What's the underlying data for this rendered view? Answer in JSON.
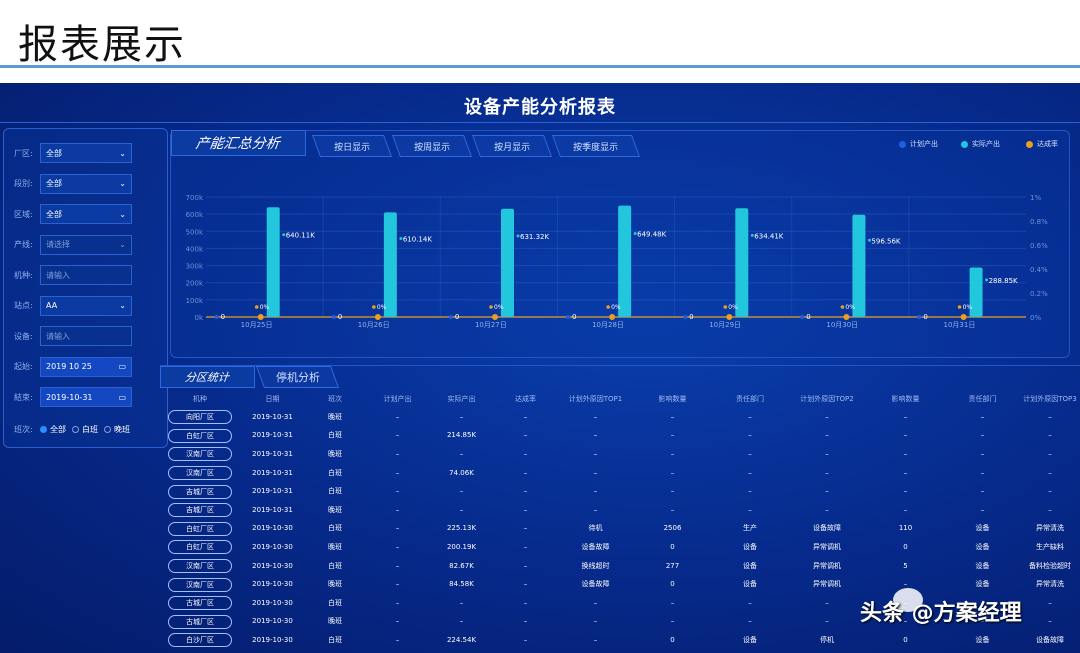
{
  "page_title": "报表展示",
  "dashboard_title": "设备产能分析报表",
  "filters": [
    {
      "label": "厂区:",
      "value": "全部",
      "type": "select"
    },
    {
      "label": "段別:",
      "value": "全部",
      "type": "select"
    },
    {
      "label": "区域:",
      "value": "全部",
      "type": "select"
    },
    {
      "label": "产线:",
      "placeholder": "请选择",
      "type": "select"
    },
    {
      "label": "机种:",
      "placeholder": "请输入",
      "type": "input"
    },
    {
      "label": "站点:",
      "value": "AA",
      "type": "select"
    },
    {
      "label": "设备:",
      "placeholder": "请输入",
      "type": "input"
    },
    {
      "label": "起始:",
      "value": "2019 10 25",
      "type": "date"
    },
    {
      "label": "結束:",
      "value": "2019-10-31",
      "type": "date"
    }
  ],
  "shift": {
    "label": "班次:",
    "options": [
      "全部",
      "白班",
      "晚班"
    ],
    "selected": "全部"
  },
  "chart_tabs": {
    "main": "产能汇总分析",
    "tabs": [
      "按日显示",
      "按周显示",
      "按月显示",
      "按季度显示"
    ]
  },
  "chart_data": {
    "type": "bar",
    "categories": [
      "10月25日",
      "10月26日",
      "10月27日",
      "10月28日",
      "10月29日",
      "10月30日",
      "10月31日"
    ],
    "series": [
      {
        "name": "计划产出",
        "values": [
          0,
          0,
          0,
          0,
          0,
          0,
          0
        ],
        "labels": [
          "0",
          "0",
          "0",
          "0",
          "0",
          "0",
          "0"
        ],
        "color": "#1f5fe0"
      },
      {
        "name": "实际产出",
        "values": [
          640110,
          610140,
          631320,
          649480,
          634410,
          596560,
          288850
        ],
        "labels": [
          "640.11K",
          "610.14K",
          "631.32K",
          "649.48K",
          "634.41K",
          "596.56K",
          "288.85K"
        ],
        "color": "#22c6dd"
      },
      {
        "name": "达成率",
        "values": [
          0,
          0,
          0,
          0,
          0,
          0,
          0
        ],
        "labels": [
          "0%",
          "0%",
          "0%",
          "0%",
          "0%",
          "0%",
          "0%"
        ],
        "color": "#e8a020",
        "axis": "right"
      }
    ],
    "y_left": {
      "range": [
        0,
        700000
      ],
      "ticks": [
        "0k",
        "100k",
        "200k",
        "300k",
        "400k",
        "500k",
        "600k",
        "700k"
      ]
    },
    "y_right": {
      "range": [
        0,
        1
      ],
      "ticks": [
        "0%",
        "0.2%",
        "0.4%",
        "0.6%",
        "0.8%",
        "1%"
      ]
    },
    "legend_position": "top-right"
  },
  "table_tabs": [
    "分区统计",
    "停机分析"
  ],
  "table": {
    "columns": [
      "机种",
      "日期",
      "班次",
      "计划产出",
      "实际产出",
      "达成率",
      "计划外原因TOP1",
      "影响数量",
      "责任部门",
      "计划外原因TOP2",
      "影响数量",
      "责任部门",
      "计划外原因TOP3"
    ],
    "rows": [
      [
        "向阳厂区",
        "2019-10-31",
        "晚班",
        "–",
        "–",
        "–",
        "–",
        "–",
        "–",
        "–",
        "–",
        "–",
        "–"
      ],
      [
        "白虹厂区",
        "2019-10-31",
        "白班",
        "–",
        "214.85K",
        "–",
        "–",
        "–",
        "–",
        "–",
        "–",
        "–",
        "–"
      ],
      [
        "汉南厂区",
        "2019-10-31",
        "晚班",
        "–",
        "–",
        "–",
        "–",
        "–",
        "–",
        "–",
        "–",
        "–",
        "–"
      ],
      [
        "汉南厂区",
        "2019-10-31",
        "白班",
        "–",
        "74.06K",
        "–",
        "–",
        "–",
        "–",
        "–",
        "–",
        "–",
        "–"
      ],
      [
        "吉城厂区",
        "2019-10-31",
        "白班",
        "–",
        "–",
        "–",
        "–",
        "–",
        "–",
        "–",
        "–",
        "–",
        "–"
      ],
      [
        "吉城厂区",
        "2019-10-31",
        "晚班",
        "–",
        "–",
        "–",
        "–",
        "–",
        "–",
        "–",
        "–",
        "–",
        "–"
      ],
      [
        "白虹厂区",
        "2019-10-30",
        "白班",
        "–",
        "225.13K",
        "–",
        "待机",
        "2506",
        "生产",
        "设备故障",
        "110",
        "设备",
        "异常清洗"
      ],
      [
        "白虹厂区",
        "2019-10-30",
        "晚班",
        "–",
        "200.19K",
        "–",
        "设备故障",
        "0",
        "设备",
        "异常调机",
        "0",
        "设备",
        "生产缺料"
      ],
      [
        "汉南厂区",
        "2019-10-30",
        "白班",
        "–",
        "82.67K",
        "–",
        "换线超时",
        "277",
        "设备",
        "异常调机",
        "5",
        "设备",
        "备料检验超时"
      ],
      [
        "汉南厂区",
        "2019-10-30",
        "晚班",
        "–",
        "84.58K",
        "–",
        "设备故障",
        "0",
        "设备",
        "异常调机",
        "–",
        "设备",
        "异常清洗"
      ],
      [
        "古城厂区",
        "2019-10-30",
        "白班",
        "–",
        "–",
        "–",
        "–",
        "–",
        "–",
        "–",
        "–",
        "–",
        "–"
      ],
      [
        "古城厂区",
        "2019-10-30",
        "晚班",
        "–",
        "–",
        "–",
        "–",
        "–",
        "–",
        "–",
        "–",
        "–",
        "–"
      ],
      [
        "白沙厂区",
        "2019-10-30",
        "白班",
        "–",
        "224.54K",
        "–",
        "–",
        "0",
        "设备",
        "停机",
        "0",
        "设备",
        "设备故障"
      ]
    ]
  },
  "watermark": "头条 @方案经理"
}
